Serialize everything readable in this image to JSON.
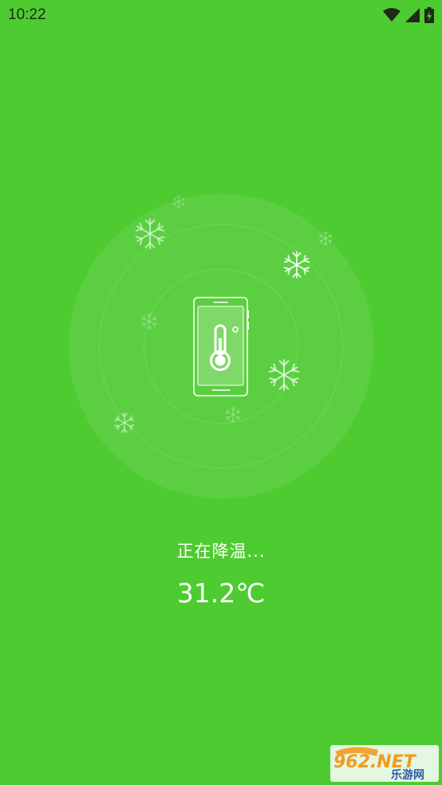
{
  "status_bar": {
    "time": "10:22",
    "icons": [
      "wifi-icon",
      "cell-signal-icon",
      "battery-charging-icon"
    ]
  },
  "main": {
    "illustration": {
      "device_icon": "phone-thermometer-icon",
      "decorations": "snowflake-icon"
    },
    "status_text": "正在降温...",
    "temperature": "31.2℃"
  },
  "watermark": {
    "top": "962.NET",
    "bottom": "乐游网"
  },
  "colors": {
    "background": "#4ecb31",
    "status_text": "#1c2a16",
    "foreground": "#ffffff",
    "watermark_orange": "#f39a1f",
    "watermark_blue": "#2f5aa8"
  }
}
